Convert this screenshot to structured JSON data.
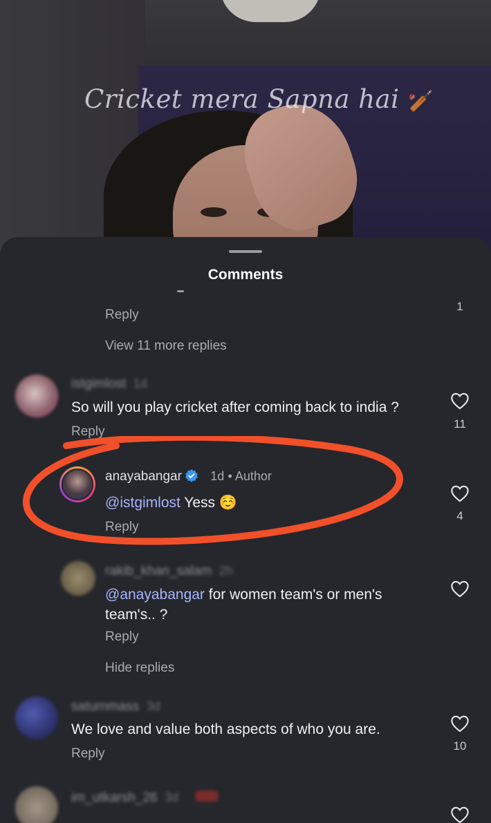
{
  "video": {
    "caption": "Cricket mera Sapna hai",
    "caption_emoji": "🏏"
  },
  "sheet": {
    "title": "Comments"
  },
  "thread_top": {
    "reply_label": "Reply",
    "like_count": "1",
    "view_more": "View 11 more replies"
  },
  "comments": [
    {
      "username": "istgimlost",
      "time": "1d",
      "text": "So will you play cricket after coming back to india ?",
      "reply_label": "Reply",
      "like_count": "11"
    },
    {
      "username": "anayabangar",
      "time": "1d",
      "badge": "Author",
      "mention": "@istgimlost",
      "text": " Yess ☺️",
      "reply_label": "Reply",
      "like_count": "4"
    },
    {
      "username": "rakib_khan_salam",
      "time": "2h",
      "mention": "@anayabangar",
      "text_line1": " for women team's or men's",
      "text_line2": "team's.. ?",
      "reply_label": "Reply",
      "hide_replies": "Hide replies"
    },
    {
      "username": "saturnmass",
      "time": "3d",
      "text": "We love and value both aspects of who you are.",
      "reply_label": "Reply",
      "like_count": "10"
    },
    {
      "username": "im_utkarsh_26",
      "time": "3d"
    }
  ],
  "colors": {
    "sheet_bg": "#25272c",
    "mention": "#a9b4ff",
    "annotation_ring": "#f2502a",
    "verified": "#3897f0"
  }
}
